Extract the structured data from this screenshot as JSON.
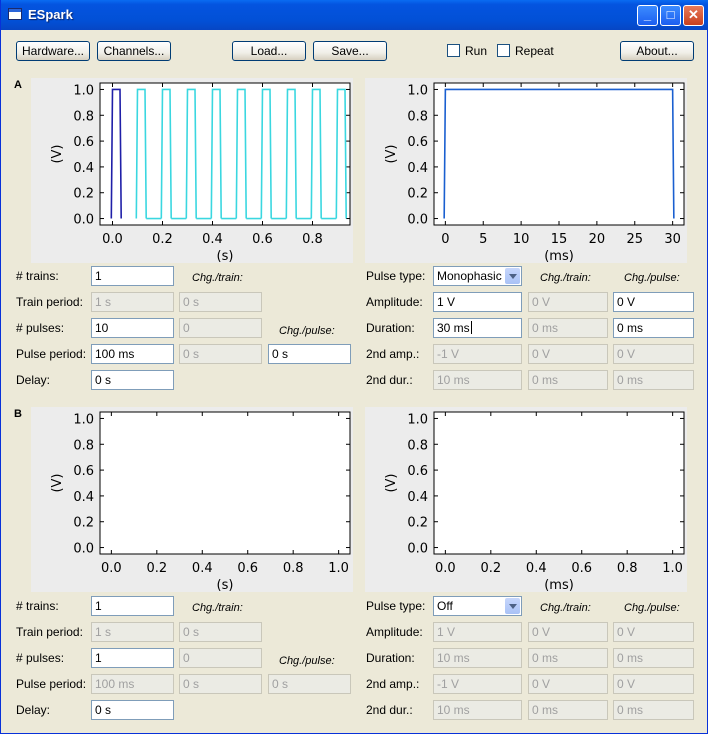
{
  "window": {
    "title": "ESpark",
    "minimize": "_",
    "maximize": "□",
    "close": "✕"
  },
  "toolbar": {
    "hardware": "Hardware...",
    "channels": "Channels...",
    "load": "Load...",
    "save": "Save...",
    "run": "Run",
    "repeat": "Repeat",
    "about": "About..."
  },
  "sections": [
    {
      "id": "A",
      "plots": {
        "left": {
          "xlabel": "(s)",
          "ylabel": "(V)"
        },
        "right": {
          "xlabel": "(ms)",
          "ylabel": "(V)"
        }
      },
      "train": {
        "trains_label": "# trains:",
        "trains": "1",
        "chg_train_label": "Chg./train:",
        "train_period_label": "Train period:",
        "train_period": "1 s",
        "train_period_chg": "0 s",
        "pulses_label": "# pulses:",
        "pulses": "10",
        "pulses_chg": "0",
        "chg_pulse_label": "Chg./pulse:",
        "pulse_period_label": "Pulse period:",
        "pulse_period": "100 ms",
        "pulse_period_chg": "0 s",
        "pulse_period_chg_pulse": "0 s",
        "delay_label": "Delay:",
        "delay": "0 s"
      },
      "pulse": {
        "type_label": "Pulse type:",
        "type": "Monophasic",
        "chg_train_label": "Chg./train:",
        "chg_pulse_label": "Chg./pulse:",
        "amp_label": "Amplitude:",
        "amp": "1 V",
        "amp_chg_train": "0 V",
        "amp_chg_pulse": "0 V",
        "dur_label": "Duration:",
        "dur": "30 ms",
        "dur_chg_train": "0 ms",
        "dur_chg_pulse": "0 ms",
        "amp2_label": "2nd amp.:",
        "amp2": "-1 V",
        "amp2_chg_train": "0 V",
        "amp2_chg_pulse": "0 V",
        "dur2_label": "2nd dur.:",
        "dur2": "10 ms",
        "dur2_chg_train": "0 ms",
        "dur2_chg_pulse": "0 ms"
      }
    },
    {
      "id": "B",
      "plots": {
        "left": {
          "xlabel": "(s)",
          "ylabel": "(V)"
        },
        "right": {
          "xlabel": "(ms)",
          "ylabel": "(V)"
        }
      },
      "train": {
        "trains_label": "# trains:",
        "trains": "1",
        "chg_train_label": "Chg./train:",
        "train_period_label": "Train period:",
        "train_period": "1 s",
        "train_period_chg": "0 s",
        "pulses_label": "# pulses:",
        "pulses": "1",
        "pulses_chg": "0",
        "chg_pulse_label": "Chg./pulse:",
        "pulse_period_label": "Pulse period:",
        "pulse_period": "100 ms",
        "pulse_period_chg": "0 s",
        "pulse_period_chg_pulse": "0 s",
        "delay_label": "Delay:",
        "delay": "0 s"
      },
      "pulse": {
        "type_label": "Pulse type:",
        "type": "Off",
        "chg_train_label": "Chg./train:",
        "chg_pulse_label": "Chg./pulse:",
        "amp_label": "Amplitude:",
        "amp": "1 V",
        "amp_chg_train": "0 V",
        "amp_chg_pulse": "0 V",
        "dur_label": "Duration:",
        "dur": "10 ms",
        "dur_chg_train": "0 ms",
        "dur_chg_pulse": "0 ms",
        "amp2_label": "2nd amp.:",
        "amp2": "-1 V",
        "amp2_chg_train": "0 V",
        "amp2_chg_pulse": "0 V",
        "dur2_label": "2nd dur.:",
        "dur2": "10 ms",
        "dur2_chg_train": "0 ms",
        "dur2_chg_pulse": "0 ms"
      }
    }
  ],
  "chart_data": [
    {
      "type": "line",
      "panel": "A-train",
      "xlabel": "(s)",
      "ylabel": "(V)",
      "xlim": [
        -0.05,
        0.95
      ],
      "ylim": [
        -0.05,
        1.05
      ],
      "xticks": [
        "0.0",
        "0.2",
        "0.4",
        "0.6",
        "0.8"
      ],
      "yticks": [
        "0.0",
        "0.2",
        "0.4",
        "0.6",
        "0.8",
        "1.0"
      ],
      "series": [
        {
          "color": "#1f1fa8",
          "pulses_start": [
            0.0
          ],
          "pulse_width": 0.03,
          "low": 0,
          "high": 1
        },
        {
          "color": "#3ad7e0",
          "pulses_start": [
            0.1,
            0.2,
            0.3,
            0.4,
            0.5,
            0.6,
            0.7,
            0.8,
            0.9
          ],
          "pulse_width": 0.03,
          "low": 0,
          "high": 1
        }
      ]
    },
    {
      "type": "line",
      "panel": "A-pulse",
      "xlabel": "(ms)",
      "ylabel": "(V)",
      "xlim": [
        -1.5,
        31.5
      ],
      "ylim": [
        -0.05,
        1.05
      ],
      "xticks": [
        "0",
        "5",
        "10",
        "15",
        "20",
        "25",
        "30"
      ],
      "yticks": [
        "0.0",
        "0.2",
        "0.4",
        "0.6",
        "0.8",
        "1.0"
      ],
      "series": [
        {
          "color": "#1a5fd0",
          "pulses_start": [
            0
          ],
          "pulse_width": 30,
          "low": 0,
          "high": 1
        }
      ]
    },
    {
      "type": "line",
      "panel": "B-train",
      "xlabel": "(s)",
      "ylabel": "(V)",
      "xlim": [
        -0.05,
        1.05
      ],
      "ylim": [
        -0.05,
        1.05
      ],
      "xticks": [
        "0.0",
        "0.2",
        "0.4",
        "0.6",
        "0.8",
        "1.0"
      ],
      "yticks": [
        "0.0",
        "0.2",
        "0.4",
        "0.6",
        "0.8",
        "1.0"
      ],
      "series": []
    },
    {
      "type": "line",
      "panel": "B-pulse",
      "xlabel": "(ms)",
      "ylabel": "(V)",
      "xlim": [
        -0.05,
        1.05
      ],
      "ylim": [
        -0.05,
        1.05
      ],
      "xticks": [
        "0.0",
        "0.2",
        "0.4",
        "0.6",
        "0.8",
        "1.0"
      ],
      "yticks": [
        "0.0",
        "0.2",
        "0.4",
        "0.6",
        "0.8",
        "1.0"
      ],
      "series": []
    }
  ]
}
